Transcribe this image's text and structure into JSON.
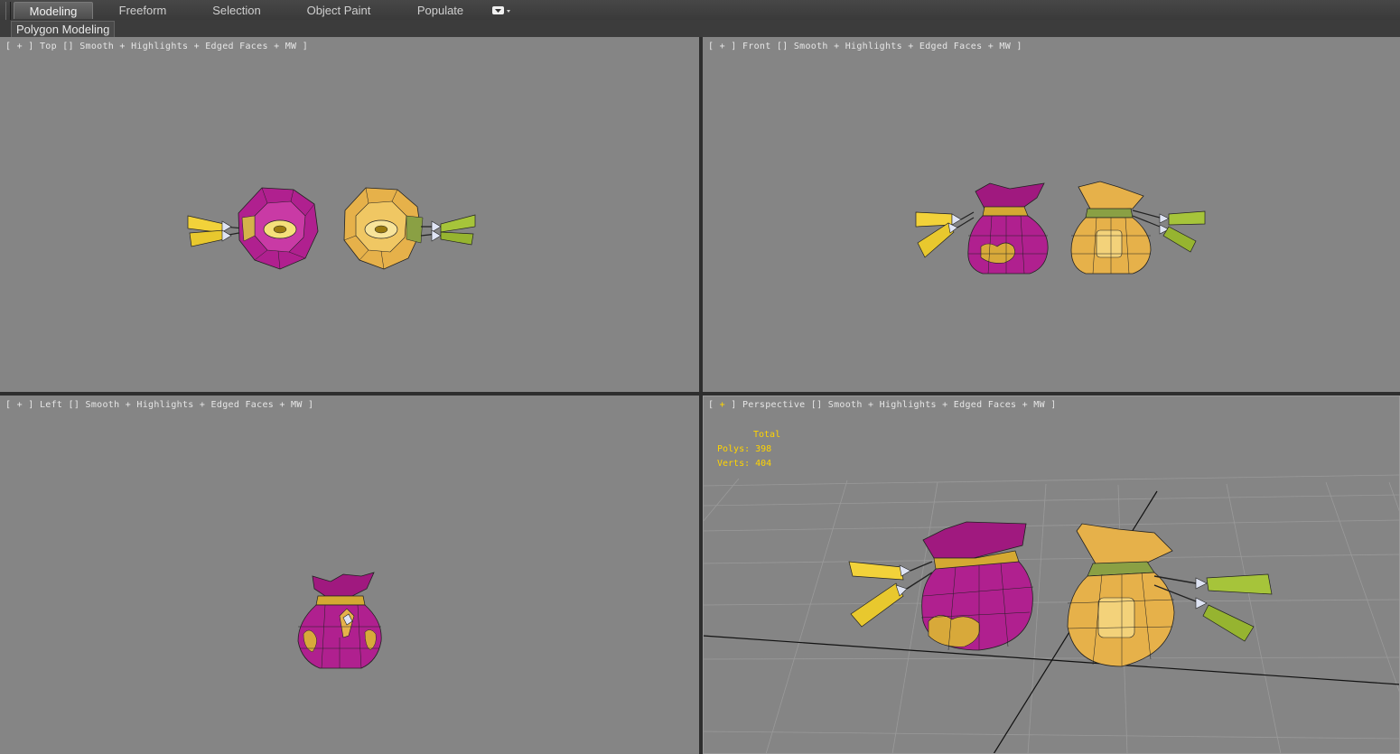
{
  "ribbon": {
    "tabs": [
      {
        "label": "Modeling",
        "active": true
      },
      {
        "label": "Freeform",
        "active": false
      },
      {
        "label": "Selection",
        "active": false
      },
      {
        "label": "Object Paint",
        "active": false
      },
      {
        "label": "Populate",
        "active": false
      }
    ],
    "panel_label": "Polygon Modeling",
    "dropdown_icon": "window-dropdown-icon"
  },
  "viewports": {
    "top": {
      "label_rest": " ] Top [] Smooth + Highlights + Edged Faces + MW ]",
      "plus": "+"
    },
    "front": {
      "label_rest": " ] Front [] Smooth + Highlights + Edged Faces + MW ]",
      "plus": "+"
    },
    "left": {
      "label_rest": " ] Left [] Smooth + Highlights + Edged Faces + MW ]",
      "plus": "+"
    },
    "perspective": {
      "label_rest": " ] Perspective [] Smooth + Highlights + Edged Faces + MW ]",
      "plus": "+"
    }
  },
  "stats": {
    "total_label": "Total",
    "polys": "Polys: 398",
    "verts": "Verts: 404"
  },
  "colors": {
    "viewport_bg": "#858585",
    "purple_bag": "#b0208f",
    "gold_bag": "#e6b14a",
    "tassel_yellow": "#f2d23a",
    "tassel_green": "#a6c43a",
    "stats_yellow": "#ffd400"
  }
}
